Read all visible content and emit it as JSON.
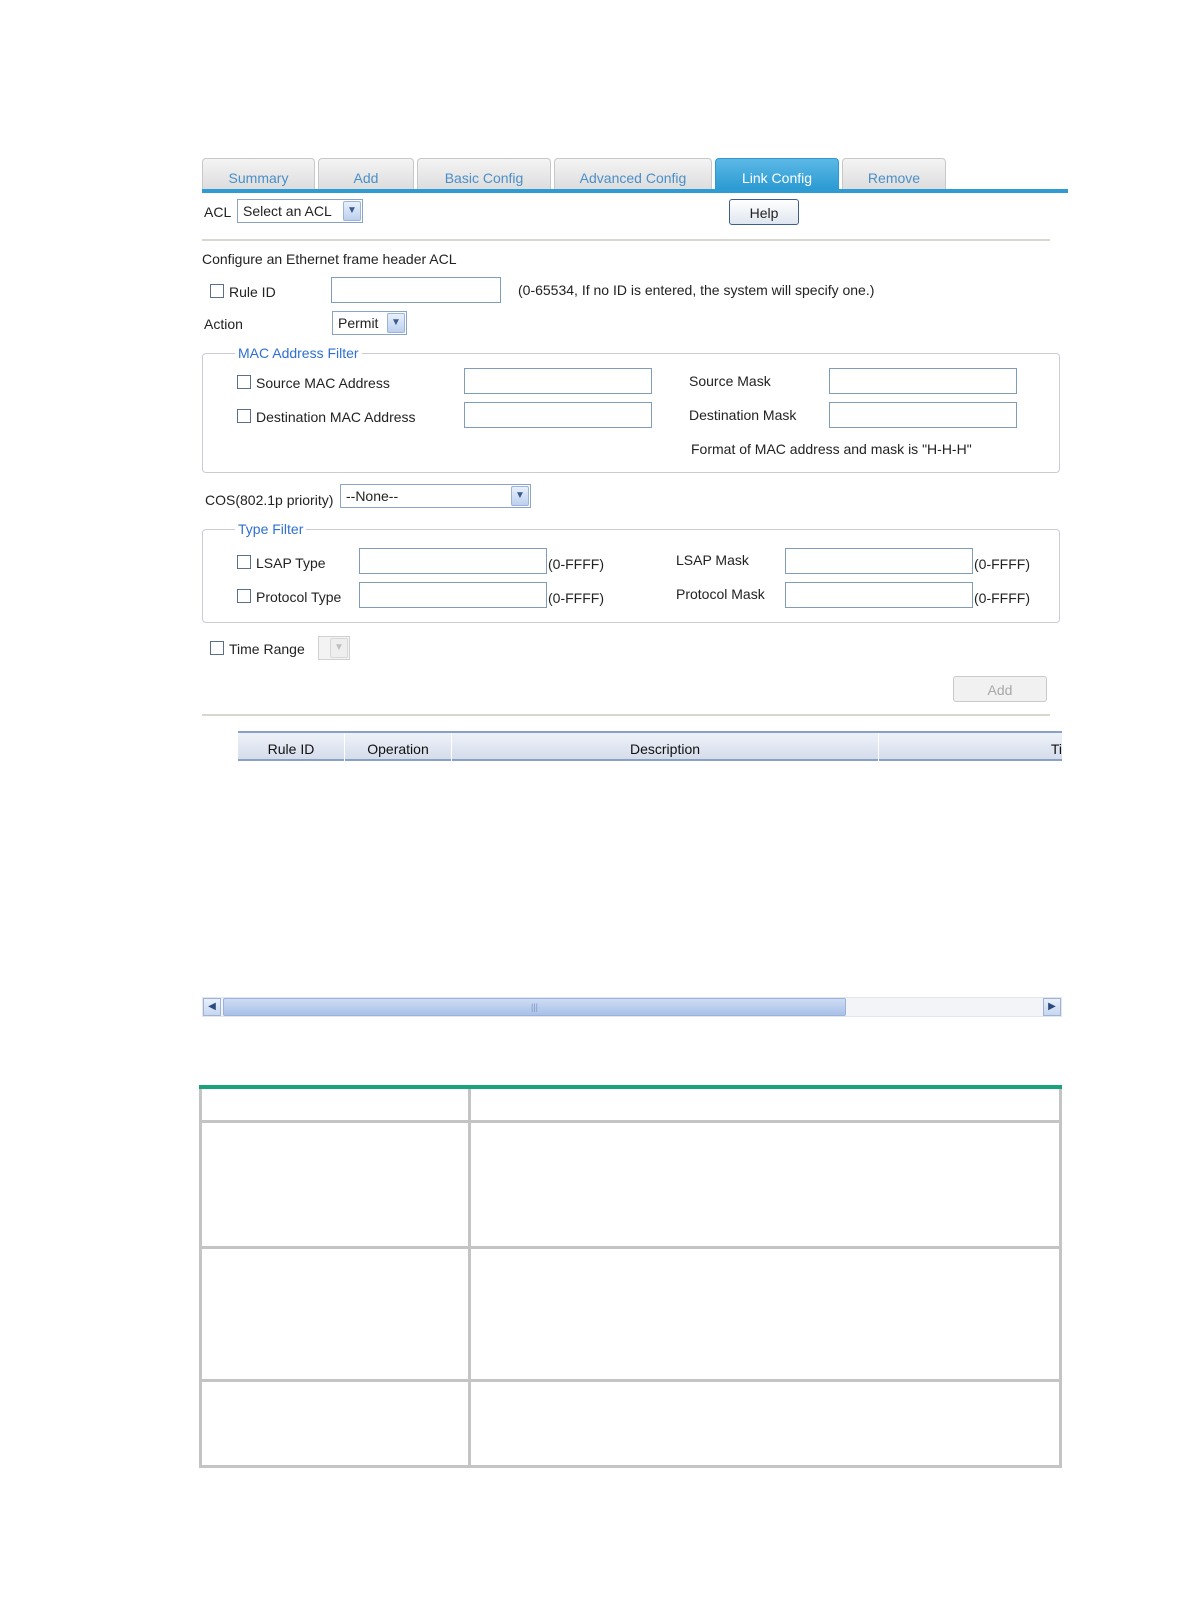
{
  "tabs": [
    {
      "label": "Summary",
      "active": false
    },
    {
      "label": "Add",
      "active": false
    },
    {
      "label": "Basic Config",
      "active": false
    },
    {
      "label": "Advanced Config",
      "active": false
    },
    {
      "label": "Link Config",
      "active": true
    },
    {
      "label": "Remove",
      "active": false
    }
  ],
  "acl": {
    "label": "ACL",
    "selected": "Select an ACL"
  },
  "help_button": "Help",
  "section_title": "Configure an Ethernet frame header ACL",
  "rule_id": {
    "label": "Rule ID",
    "value": "",
    "hint": "(0-65534, If no ID is entered, the system will specify one.)"
  },
  "action": {
    "label": "Action",
    "selected": "Permit"
  },
  "mac_filter": {
    "legend": "MAC Address Filter",
    "source_mac_label": "Source MAC Address",
    "dest_mac_label": "Destination MAC Address",
    "source_mask_label": "Source Mask",
    "dest_mask_label": "Destination Mask",
    "format_note": "Format of MAC address and mask is \"H-H-H\""
  },
  "cos": {
    "label": "COS(802.1p priority)",
    "selected": "--None--"
  },
  "type_filter": {
    "legend": "Type Filter",
    "lsap_type_label": "LSAP Type",
    "protocol_type_label": "Protocol Type",
    "lsap_mask_label": "LSAP Mask",
    "protocol_mask_label": "Protocol Mask",
    "range_hint": "(0-FFFF)"
  },
  "time_range": {
    "label": "Time Range"
  },
  "add_button": "Add",
  "rules_table": {
    "columns": [
      "Rule ID",
      "Operation",
      "Description",
      "Ti"
    ]
  },
  "scrollbar": {
    "thumb_fraction": 0.76
  },
  "colors": {
    "accent": "#2e9bd3",
    "doc_table_top": "#1aa37a",
    "legend": "#2f6fd1"
  }
}
